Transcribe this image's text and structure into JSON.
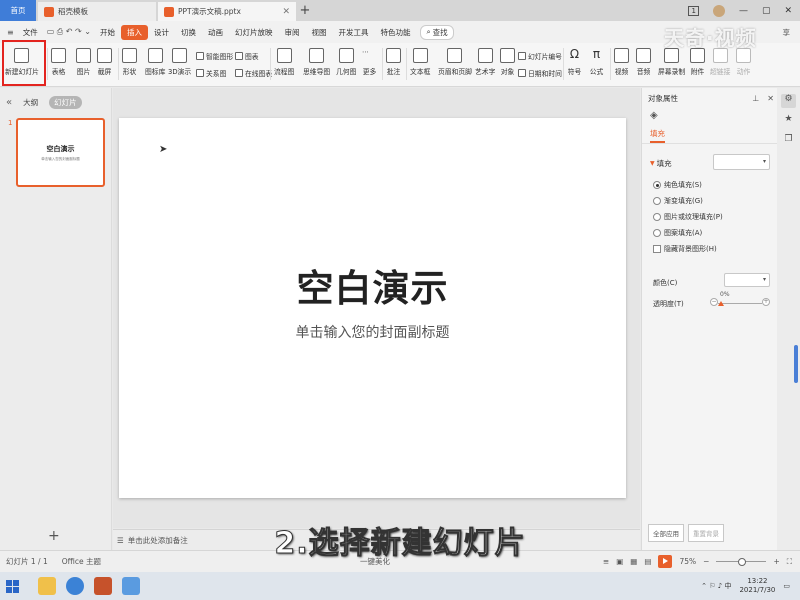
{
  "tabs": {
    "home": "首页",
    "template": "稻壳模板",
    "doc": "PPT演示文稿.pptx"
  },
  "window": {
    "badge": "1",
    "minimize": "—",
    "maximize": "▢",
    "close": "✕"
  },
  "menu": {
    "file": "文件",
    "items": [
      "开始",
      "插入",
      "设计",
      "切换",
      "动画",
      "幻灯片放映",
      "审阅",
      "视图",
      "开发工具",
      "特色功能"
    ],
    "active_index": 1,
    "search": "查找",
    "right_tail": "享"
  },
  "ribbon": {
    "new_slide": "新建幻灯片",
    "table": "表格",
    "picture": "图片",
    "screenshot": "截屏",
    "shape": "形状",
    "icon_lib": "图标库",
    "model3d": "3D演示",
    "smartart": "智能图形",
    "relation": "关系图",
    "chart": "图表",
    "online_chart": "在线图表",
    "flowchart": "流程图",
    "mindmap": "思维导图",
    "geometry": "几何图",
    "more": "更多",
    "annotation": "批注",
    "textbox": "文本框",
    "header_footer": "页眉和页脚",
    "wordart": "艺术字",
    "object": "对象",
    "slide_number": "幻灯片编号",
    "datetime": "日期和时间",
    "symbol": "符号",
    "formula": "公式",
    "video": "视频",
    "audio": "音频",
    "screen_record": "屏幕录制",
    "attach": "附件",
    "hyperlink": "超链接",
    "action": "动作"
  },
  "left_panel": {
    "outline": "大纲",
    "slides": "幻灯片",
    "thumb_number": "1",
    "thumb_title": "空白演示",
    "thumb_sub": "单击输入您的封面副标题",
    "add": "+"
  },
  "slide": {
    "title": "空白演示",
    "subtitle": "单击输入您的封面副标题"
  },
  "notes": "单击此处添加备注",
  "properties": {
    "header": "对象属性",
    "tab": "填充",
    "fill_label": "填充",
    "options": [
      "纯色填充(S)",
      "渐变填充(G)",
      "图片或纹理填充(P)",
      "图案填充(A)"
    ],
    "selected_option": 0,
    "hide_bg": "隐藏背景图形(H)",
    "color_label": "颜色(C)",
    "transparency_label": "透明度(T)",
    "transparency_value": "0%",
    "apply_all": "全部应用",
    "reset_bg": "重置背景"
  },
  "status": {
    "slide_count": "幻灯片 1 / 1",
    "theme": "Office 主题",
    "beautify": "一键美化",
    "zoom": "75%"
  },
  "taskbar": {
    "time": "13:22",
    "date": "2021/7/30"
  },
  "overlay": {
    "step_caption": "2.选择新建幻灯片",
    "watermark": "天奇·视频"
  },
  "colors": {
    "accent": "#e8602c",
    "highlight": "#e3241f",
    "home_tab": "#3f7dd8"
  }
}
